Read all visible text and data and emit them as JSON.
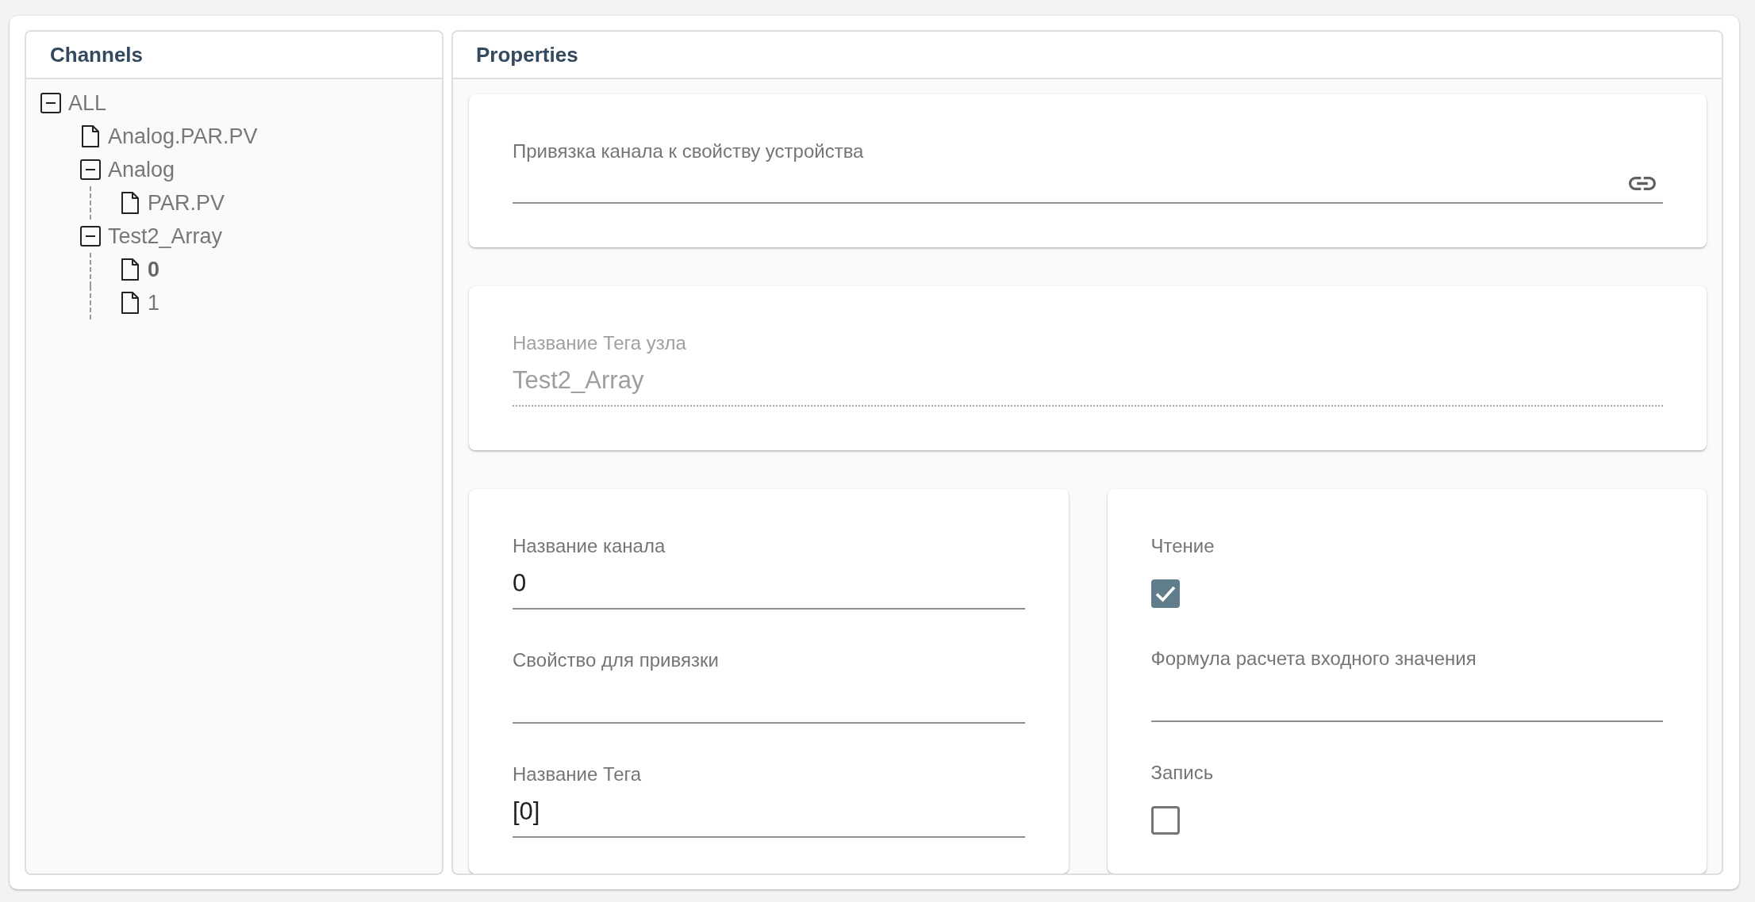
{
  "channels_panel": {
    "title": "Channels",
    "tree": [
      {
        "label": "ALL",
        "kind": "folder",
        "expanded": true,
        "selected": false,
        "children": [
          {
            "label": "Analog.PAR.PV",
            "kind": "file",
            "selected": false
          },
          {
            "label": "Analog",
            "kind": "folder",
            "expanded": true,
            "selected": false,
            "children": [
              {
                "label": "PAR.PV",
                "kind": "file",
                "selected": false
              }
            ]
          },
          {
            "label": "Test2_Array",
            "kind": "folder",
            "expanded": true,
            "selected": false,
            "children": [
              {
                "label": "0",
                "kind": "file",
                "selected": true
              },
              {
                "label": "1",
                "kind": "file",
                "selected": false
              }
            ]
          }
        ]
      }
    ]
  },
  "properties_panel": {
    "title": "Properties",
    "card_rows": [
      {
        "cards": [
          {
            "fields": [
              {
                "kind": "link",
                "label": "Привязка канала к свойству устройства",
                "disabled": false
              }
            ]
          }
        ]
      },
      {
        "cards": [
          {
            "fields": [
              {
                "kind": "text",
                "label": "Название Тега узла",
                "value": "Test2_Array",
                "disabled": true
              }
            ]
          }
        ]
      },
      {
        "cards": [
          {
            "fields": [
              {
                "kind": "text",
                "label": "Название канала",
                "value": "0",
                "disabled": false
              },
              {
                "kind": "text",
                "label": "Свойство для привязки",
                "disabled": false
              },
              {
                "kind": "text",
                "label": "Название Тега",
                "value": "[0]",
                "disabled": false
              }
            ]
          },
          {
            "fields": [
              {
                "kind": "checkbox",
                "label": "Чтение",
                "checked": true,
                "disabled": false
              },
              {
                "kind": "text",
                "label": "Формула расчета входного значения",
                "disabled": false
              },
              {
                "kind": "checkbox",
                "label": "Запись",
                "checked": false,
                "disabled": false
              }
            ]
          }
        ]
      }
    ]
  }
}
